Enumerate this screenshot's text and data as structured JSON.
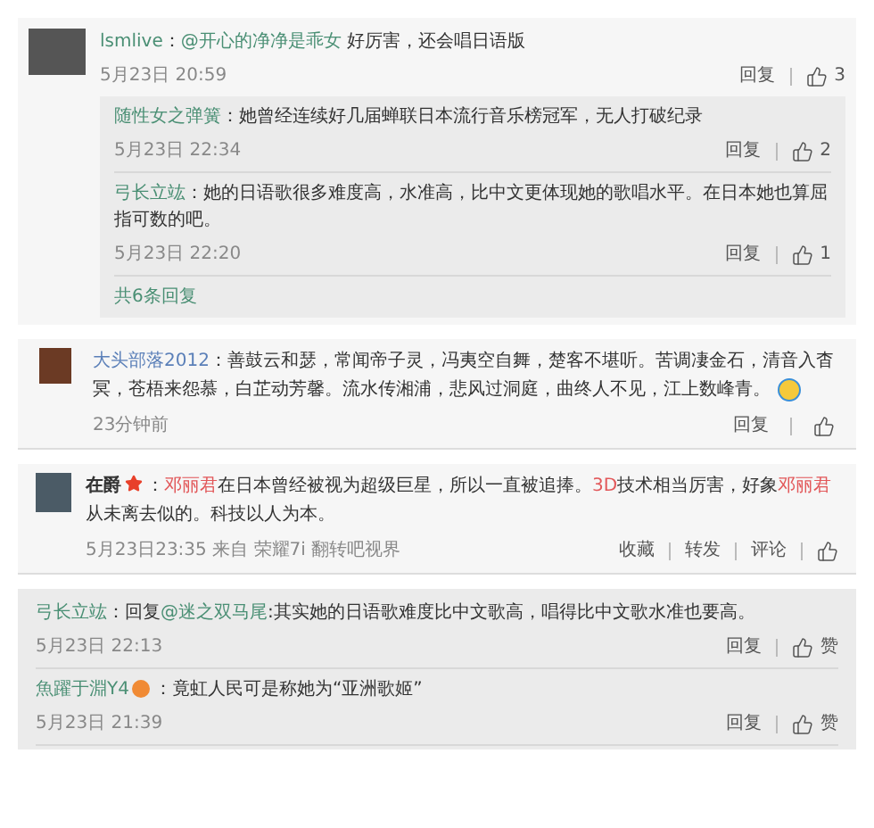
{
  "panels": [
    {
      "kind": "thread",
      "user": "lsmlive",
      "body": [
        {
          "kind": "plain",
          "text": "："
        },
        {
          "kind": "mention",
          "text": "@开心的净净是乖女"
        },
        {
          "kind": "plain",
          "text": " 好厉害，还会唱日语版"
        }
      ],
      "time": "5月23日 20:59",
      "reply": "回复",
      "likes": "3",
      "replies": [
        {
          "user": "随性女之弹簧",
          "body": [
            {
              "kind": "plain",
              "text": "：她曾经连续好几届蝉联日本流行音乐榜冠军，无人打破纪录"
            }
          ],
          "time": "5月23日 22:34",
          "reply": "回复",
          "likes": "2"
        },
        {
          "user": "弓长立竑",
          "body": [
            {
              "kind": "plain",
              "text": "：她的日语歌很多难度高，水准高，比中文更体现她的歌唱水平。在日本她也算屈指可数的吧。"
            }
          ],
          "time": "5月23日 22:20",
          "reply": "回复",
          "likes": "1"
        }
      ],
      "more": "共6条回复"
    },
    {
      "kind": "comment",
      "user": "大头部落2012",
      "body": [
        {
          "kind": "plain",
          "text": "：善鼓云和瑟，常闻帝子灵，冯夷空自舞，楚客不堪听。苦调凄金石，清音入杳冥，苍梧来怨慕，白芷动芳馨。流水传湘浦，悲风过洞庭，曲终人不见，江上数峰青。"
        }
      ],
      "emoji": true,
      "time": "23分钟前",
      "reply": "回复"
    },
    {
      "kind": "post",
      "user": "在爵",
      "star": true,
      "body": [
        {
          "kind": "plain",
          "text": "："
        },
        {
          "kind": "keyword",
          "text": "邓丽君"
        },
        {
          "kind": "plain",
          "text": "在日本曾经被视为超级巨星，所以一直被追捧。"
        },
        {
          "kind": "keyword",
          "text": "3D"
        },
        {
          "kind": "plain",
          "text": "技术相当厉害，好象"
        },
        {
          "kind": "keyword",
          "text": "邓丽君"
        },
        {
          "kind": "plain",
          "text": "从未离去似的。科技以人为本。"
        }
      ],
      "meta": "5月23日23:35 来自 荣耀7i 翻转吧视界",
      "actions": [
        "收藏",
        "转发",
        "评论"
      ]
    },
    {
      "kind": "replies",
      "replies": [
        {
          "user": "弓长立竑",
          "badge": false,
          "body": [
            {
              "kind": "plain",
              "text": "：回复"
            },
            {
              "kind": "mention",
              "text": "@迷之双马尾"
            },
            {
              "kind": "plain",
              "text": ":其实她的日语歌难度比中文歌高，唱得比中文歌水准也要高。"
            }
          ],
          "time": "5月23日 22:13",
          "reply": "回复",
          "likes": "赞"
        },
        {
          "user": "魚躍于淵Y4",
          "badge": true,
          "body": [
            {
              "kind": "plain",
              "text": "：竟虹人民可是称她为“亚洲歌姬”"
            }
          ],
          "time": "5月23日 21:39",
          "reply": "回复",
          "likes": "赞"
        }
      ]
    }
  ]
}
